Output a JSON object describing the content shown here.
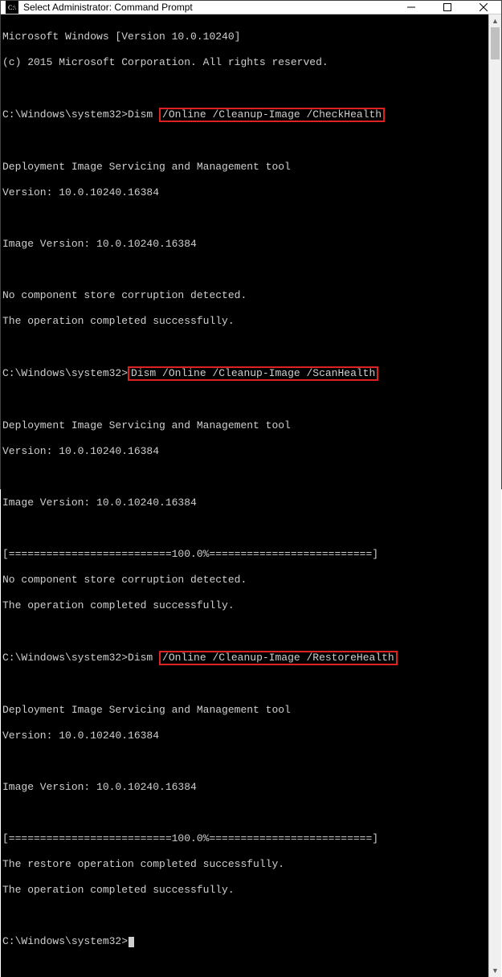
{
  "window": {
    "title": "Select Administrator: Command Prompt"
  },
  "terminal": {
    "line_winver": "Microsoft Windows [Version 10.0.10240]",
    "line_copyright": "(c) 2015 Microsoft Corporation. All rights reserved.",
    "prompt1_prefix": "C:\\Windows\\system32>Dism ",
    "prompt1_hl": "/Online /Cleanup-Image /CheckHealth",
    "tool_header": "Deployment Image Servicing and Management tool",
    "tool_version": "Version: 10.0.10240.16384",
    "image_version": "Image Version: 10.0.10240.16384",
    "no_corruption": "No component store corruption detected.",
    "op_success": "The operation completed successfully.",
    "prompt2_prefix": "C:\\Windows\\system32>",
    "prompt2_hl": "Dism /Online /Cleanup-Image /ScanHealth",
    "progress": "[==========================100.0%==========================]",
    "prompt3_prefix": "C:\\Windows\\system32>Dism ",
    "prompt3_hl": "/Online /Cleanup-Image /RestoreHealth",
    "restore_success": "The restore operation completed successfully.",
    "final_prompt": "C:\\Windows\\system32>"
  }
}
